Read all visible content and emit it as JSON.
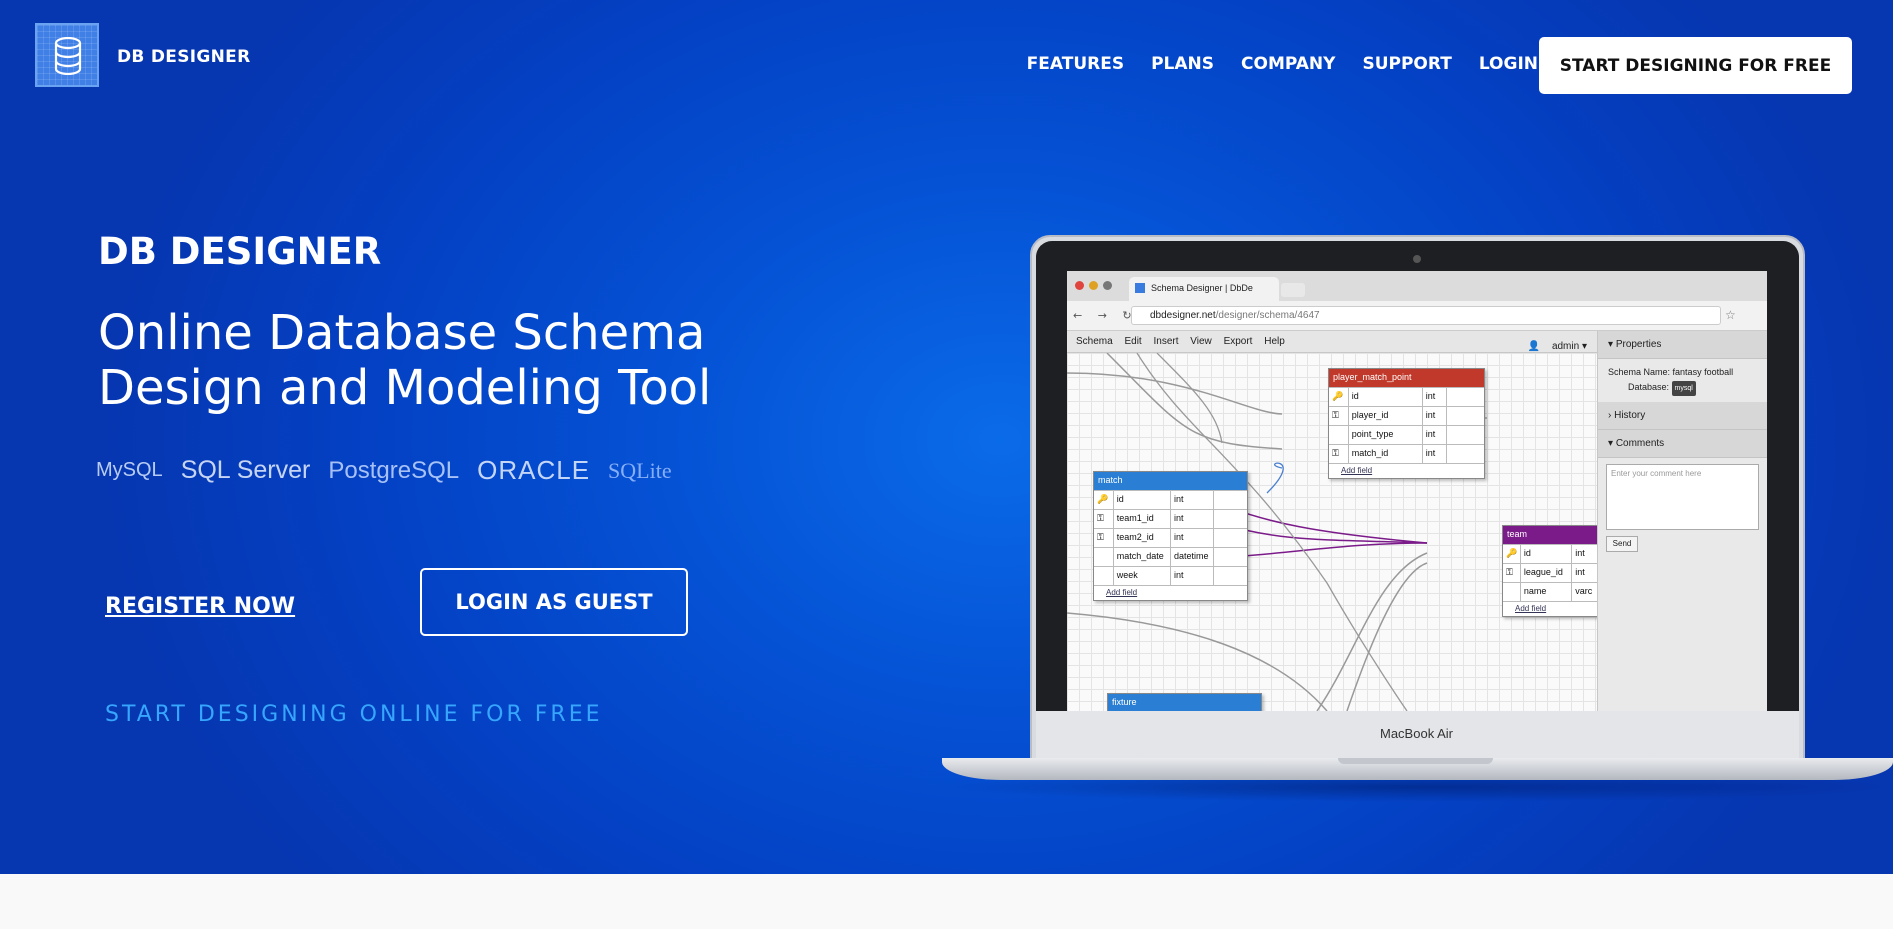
{
  "header": {
    "brand": "DB DESIGNER",
    "nav": [
      "FEATURES",
      "PLANS",
      "COMPANY",
      "SUPPORT",
      "LOGIN"
    ],
    "cta": "START DESIGNING FOR FREE"
  },
  "hero": {
    "title": "DB DESIGNER",
    "subtitle_line1": "Online Database Schema",
    "subtitle_line2": "Design and Modeling Tool",
    "databases": [
      "MySQL",
      "SQL Server",
      "PostgreSQL",
      "ORACLE",
      "SQLite"
    ],
    "register_label": "REGISTER NOW",
    "guest_label": "LOGIN AS GUEST",
    "free_line": "START DESIGNING ONLINE FOR FREE"
  },
  "laptop": {
    "model_label": "MacBook Air",
    "browser": {
      "tab_title": "Schema Designer | DbDe",
      "url_host": "dbdesigner.net",
      "url_path": "/designer/schema/4647",
      "menu": [
        "Schema",
        "Edit",
        "Insert",
        "View",
        "Export",
        "Help"
      ],
      "user": "admin"
    },
    "tables": [
      {
        "name": "player_match_point",
        "color": "#c0392b",
        "rows": [
          [
            "id",
            "int"
          ],
          [
            "player_id",
            "int"
          ],
          [
            "point_type",
            "int"
          ],
          [
            "match_id",
            "int"
          ]
        ],
        "add": "Add field"
      },
      {
        "name": "match",
        "color": "#2a7fd4",
        "rows": [
          [
            "id",
            "int"
          ],
          [
            "team1_id",
            "int"
          ],
          [
            "team2_id",
            "int"
          ],
          [
            "match_date",
            "datetime"
          ],
          [
            "week",
            "int"
          ]
        ],
        "add": "Add field"
      },
      {
        "name": "team",
        "color": "#7b1b8a",
        "rows": [
          [
            "id",
            "int"
          ],
          [
            "league_id",
            "int"
          ],
          [
            "name",
            "varc"
          ]
        ],
        "add": "Add field"
      },
      {
        "name": "fixture",
        "color": "#2a7fd4",
        "rows": [],
        "add": ""
      }
    ],
    "side_panel": {
      "properties": "Properties",
      "schema_name_label": "Schema Name:",
      "schema_name": "fantasy football",
      "database_label": "Database:",
      "database": "mysql",
      "history": "History",
      "comments": "Comments",
      "comment_placeholder": "Enter your comment here",
      "send": "Send"
    }
  }
}
